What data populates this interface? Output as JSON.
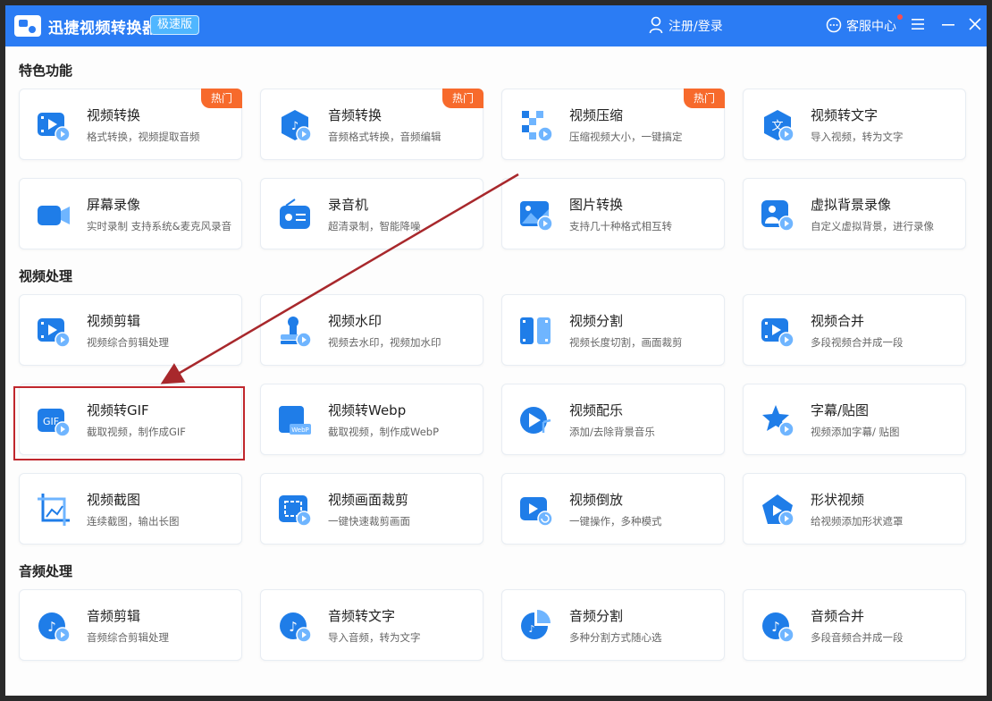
{
  "app": {
    "title": "迅捷视频转换器",
    "edition": "极速版",
    "login": "注册/登录",
    "service": "客服中心",
    "accent": "#2b7cf4",
    "hot_color": "#f76a2c",
    "highlight_color": "#c0272d"
  },
  "sections": [
    {
      "title": "特色功能",
      "cards": [
        {
          "name": "视频转换",
          "desc": "格式转换，视频提取音频",
          "badge": "热门",
          "icon": "video-convert-icon"
        },
        {
          "name": "音频转换",
          "desc": "音频格式转换，音频编辑",
          "badge": "热门",
          "icon": "audio-convert-icon"
        },
        {
          "name": "视频压缩",
          "desc": "压缩视频大小，一键搞定",
          "badge": "热门",
          "icon": "video-compress-icon"
        },
        {
          "name": "视频转文字",
          "desc": "导入视频，转为文字",
          "icon": "video-to-text-icon"
        },
        {
          "name": "屏幕录像",
          "desc": "实时录制 支持系统&麦克风录音",
          "icon": "screen-record-icon"
        },
        {
          "name": "录音机",
          "desc": "超清录制，智能降噪",
          "icon": "recorder-icon"
        },
        {
          "name": "图片转换",
          "desc": "支持几十种格式相互转",
          "icon": "image-convert-icon"
        },
        {
          "name": "虚拟背景录像",
          "desc": "自定义虚拟背景，进行录像",
          "icon": "virtual-bg-icon"
        }
      ]
    },
    {
      "title": "视频处理",
      "cards": [
        {
          "name": "视频剪辑",
          "desc": "视频综合剪辑处理",
          "icon": "video-edit-icon"
        },
        {
          "name": "视频水印",
          "desc": "视频去水印，视频加水印",
          "icon": "watermark-icon"
        },
        {
          "name": "视频分割",
          "desc": "视频长度切割，画面裁剪",
          "icon": "video-split-icon"
        },
        {
          "name": "视频合并",
          "desc": "多段视频合并成一段",
          "icon": "video-merge-icon"
        },
        {
          "name": "视频转GIF",
          "desc": "截取视频，制作成GIF",
          "icon": "gif-icon"
        },
        {
          "name": "视频转Webp",
          "desc": "截取视频，制作成WebP",
          "icon": "webp-icon"
        },
        {
          "name": "视频配乐",
          "desc": "添加/去除背景音乐",
          "icon": "music-icon"
        },
        {
          "name": "字幕/贴图",
          "desc": "视频添加字幕/ 贴图",
          "icon": "subtitle-icon"
        },
        {
          "name": "视频截图",
          "desc": "连续截图，输出长图",
          "icon": "screenshot-icon"
        },
        {
          "name": "视频画面裁剪",
          "desc": "一键快速裁剪画面",
          "icon": "crop-icon"
        },
        {
          "name": "视频倒放",
          "desc": "一键操作，多种模式",
          "icon": "reverse-icon"
        },
        {
          "name": "形状视频",
          "desc": "给视频添加形状遮罩",
          "icon": "shape-icon"
        }
      ]
    },
    {
      "title": "音频处理",
      "cards": [
        {
          "name": "音频剪辑",
          "desc": "音频综合剪辑处理",
          "icon": "audio-edit-icon"
        },
        {
          "name": "音频转文字",
          "desc": "导入音频，转为文字",
          "icon": "audio-to-text-icon"
        },
        {
          "name": "音频分割",
          "desc": "多种分割方式随心选",
          "icon": "audio-split-icon"
        },
        {
          "name": "音频合并",
          "desc": "多段音频合并成一段",
          "icon": "audio-merge-icon"
        }
      ]
    }
  ]
}
